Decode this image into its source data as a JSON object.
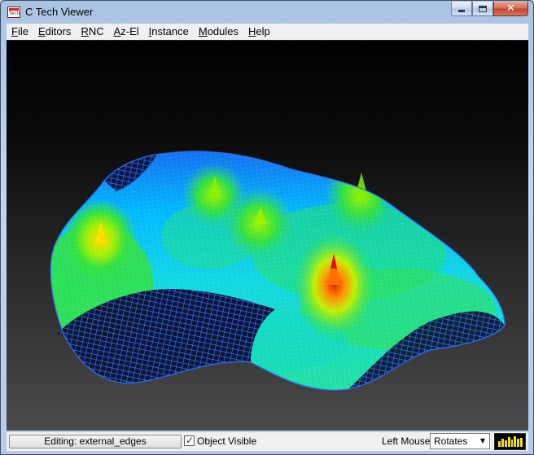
{
  "window": {
    "title": "C Tech Viewer",
    "icon_text": "Tech",
    "icon": "ctech-app-icon",
    "caption_icons": [
      "minimize-icon",
      "maximize-icon",
      "close-icon"
    ]
  },
  "menu": [
    {
      "label": "File",
      "ul": "F",
      "rest": "ile"
    },
    {
      "label": "Editors",
      "ul": "E",
      "rest": "ditors"
    },
    {
      "label": "RNC",
      "ul": "R",
      "rest": "NC"
    },
    {
      "label": "Az-El",
      "ul": "A",
      "rest": "z-El"
    },
    {
      "label": "Instance",
      "ul": "I",
      "rest": "nstance"
    },
    {
      "label": "Modules",
      "ul": "M",
      "rest": "odules"
    },
    {
      "label": "Help",
      "ul": "H",
      "rest": "elp"
    }
  ],
  "viewport": {
    "content": "3D wireframe terrain surface with five peaks",
    "background_top": "#000000",
    "background_bottom": "#4a4a4a",
    "colormap": [
      "#1010c0",
      "#0080ff",
      "#00c0ff",
      "#20e0a0",
      "#40e040",
      "#a0f000",
      "#ffe000",
      "#ff6000",
      "#e00000"
    ]
  },
  "status": {
    "editing_label": "Editing: external_edges",
    "object_visible_label": "Object Visible",
    "object_visible_checked": true,
    "left_mouse_label": "Left Mouse",
    "left_mouse_value": "Rotates",
    "activity_levels": [
      0.5,
      0.8,
      0.6,
      0.9,
      0.7,
      1.0,
      0.75,
      0.85
    ]
  }
}
